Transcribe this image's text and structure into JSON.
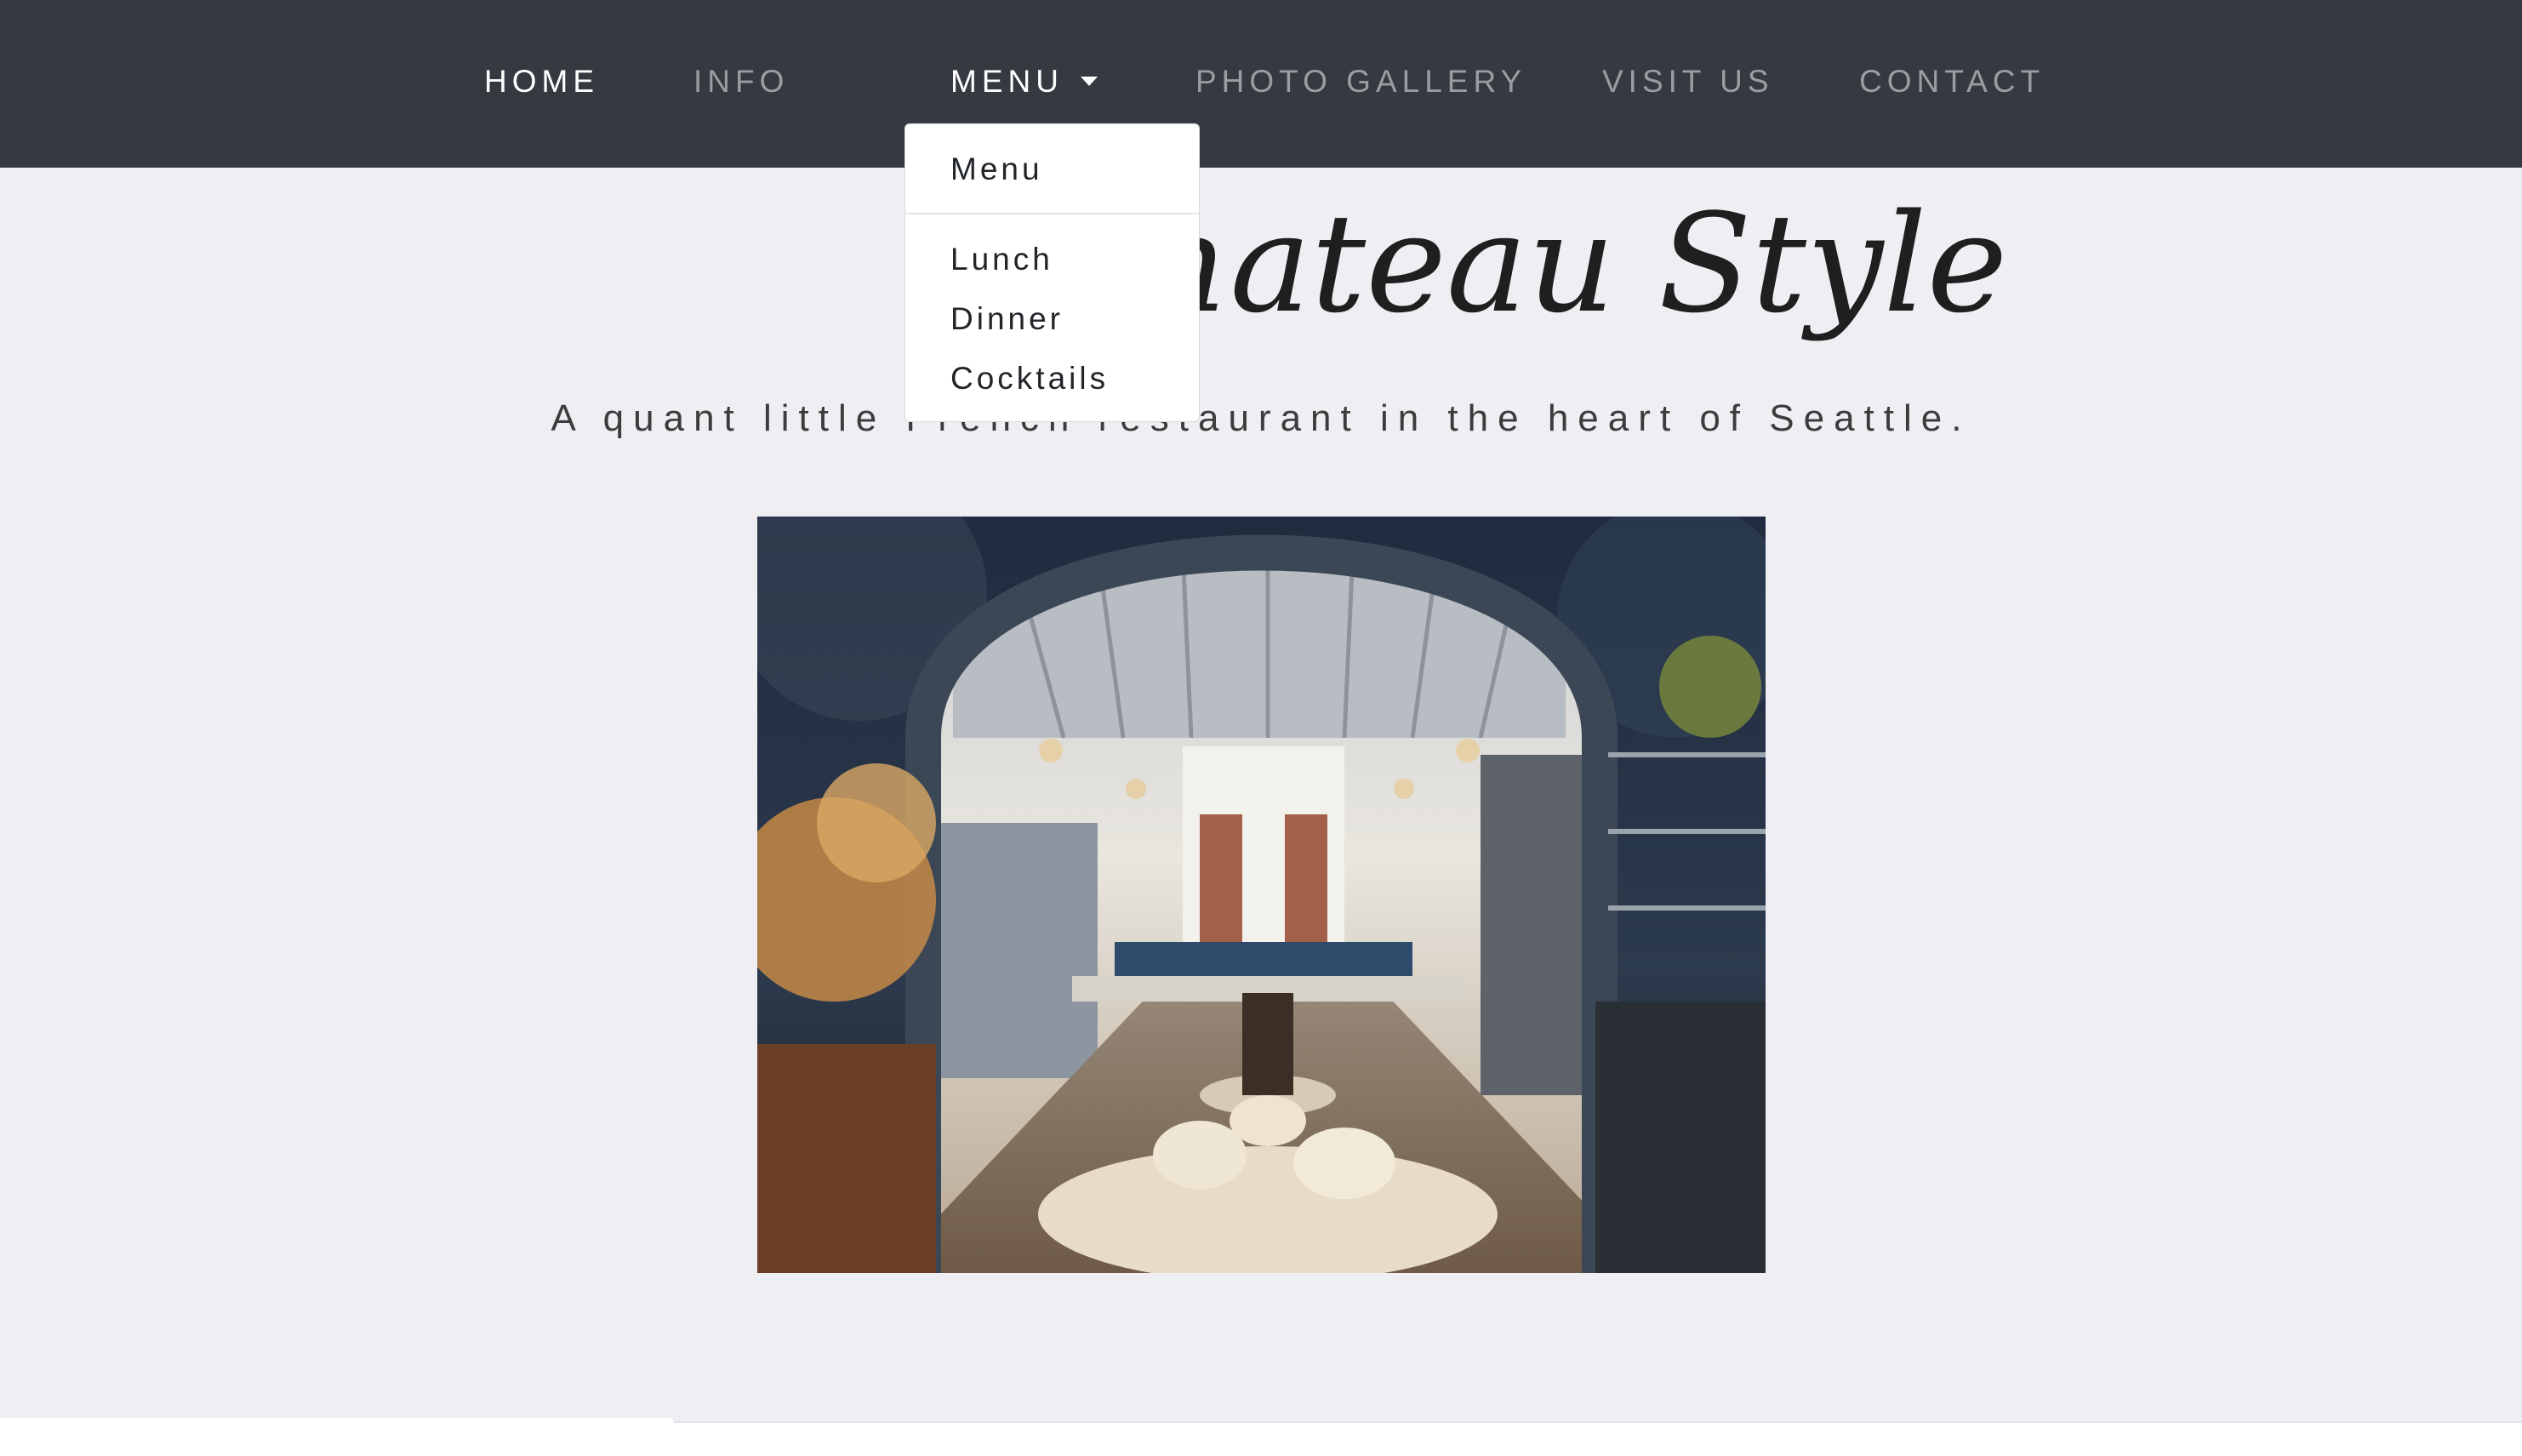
{
  "nav": {
    "home": "HOME",
    "info": "INFO",
    "menu": "MENU",
    "gallery": "PHOTO GALLERY",
    "visit": "VISIT US",
    "contact": "CONTACT"
  },
  "dropdown": {
    "header": "Menu",
    "items": [
      "Lunch",
      "Dinner",
      "Cocktails"
    ]
  },
  "hero": {
    "title": "Chateau Style",
    "tagline": "A quant little French restaurant in the heart of Seattle."
  },
  "colors": {
    "navbar": "#343a40",
    "page_background": "#efeef3",
    "active_link": "#ffffff",
    "inactive_link": "#9a9ea3"
  }
}
